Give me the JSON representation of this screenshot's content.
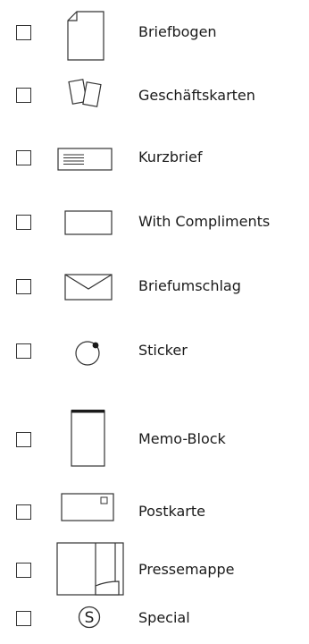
{
  "options": [
    {
      "label": "Briefbogen",
      "icon": "letterhead-icon",
      "checked": false
    },
    {
      "label": "Geschäftskarten",
      "icon": "business-cards-icon",
      "checked": false
    },
    {
      "label": "Kurzbrief",
      "icon": "short-letter-icon",
      "checked": false
    },
    {
      "label": "With Compliments",
      "icon": "compliments-slip-icon",
      "checked": false
    },
    {
      "label": "Briefumschlag",
      "icon": "envelope-icon",
      "checked": false
    },
    {
      "label": "Sticker",
      "icon": "sticker-icon",
      "checked": false
    },
    {
      "label": "Memo-Block",
      "icon": "memo-pad-icon",
      "checked": false
    },
    {
      "label": "Postkarte",
      "icon": "postcard-icon",
      "checked": false
    },
    {
      "label": "Pressemappe",
      "icon": "press-folder-icon",
      "checked": false
    },
    {
      "label": "Special",
      "icon": "special-icon",
      "checked": false
    }
  ]
}
